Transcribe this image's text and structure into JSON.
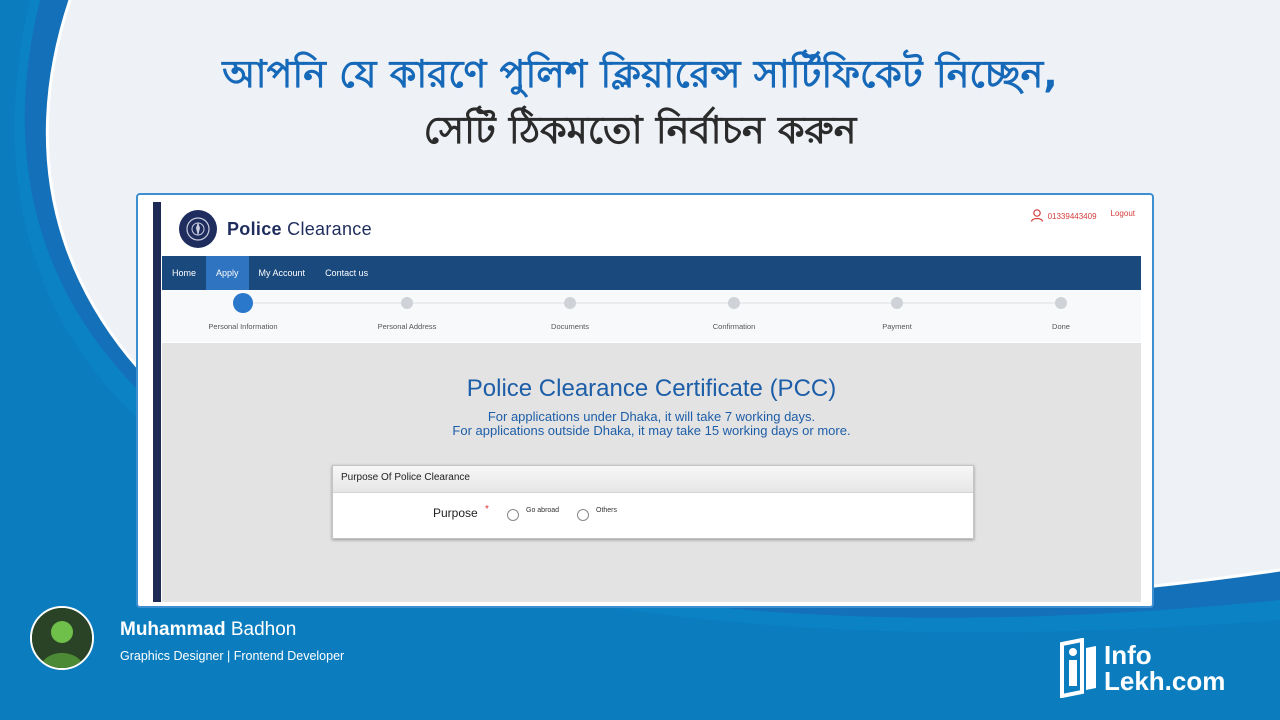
{
  "banner": {
    "line1": "আপনি যে কারণে পুলিশ ক্লিয়ারেন্স সার্টিফিকেট নিচ্ছেন,",
    "line2": "সেটি ঠিকমতো নির্বাচন করুন"
  },
  "app": {
    "brand_bold": "Police",
    "brand_rest": "Clearance",
    "user_phone": "01339443409",
    "logout_label": "Logout",
    "nav": [
      {
        "label": "Home"
      },
      {
        "label": "Apply"
      },
      {
        "label": "My Account"
      },
      {
        "label": "Contact us"
      }
    ],
    "active_nav": "Apply",
    "steps": [
      "Personal Information",
      "Personal Address",
      "Documents",
      "Confirmation",
      "Payment",
      "Done"
    ],
    "current_step": 1,
    "pcc_title": "Police Clearance Certificate (PCC)",
    "info_line1": "For applications under Dhaka, it will take 7 working days.",
    "info_line2": "For applications outside Dhaka, it may take 15 working days or more.",
    "purpose_card_title": "Purpose Of Police Clearance",
    "purpose_label": "Purpose",
    "required_mark": "*",
    "purpose_options": [
      "Go abroad",
      "Others"
    ]
  },
  "footer": {
    "name_bold": "Muhammad",
    "name_rest": "Badhon",
    "role": "Graphics Designer | Frontend Developer",
    "logo_line1": "Info",
    "logo_line2": "Lekh.com"
  },
  "colors": {
    "accent_blue": "#1668b8",
    "nav_blue": "#19497d",
    "nav_active": "#2e74c0",
    "footer_blue": "#0c7ec0"
  },
  "icons": [
    "police-emblem-icon",
    "user-icon",
    "infolekh-logo-icon"
  ]
}
